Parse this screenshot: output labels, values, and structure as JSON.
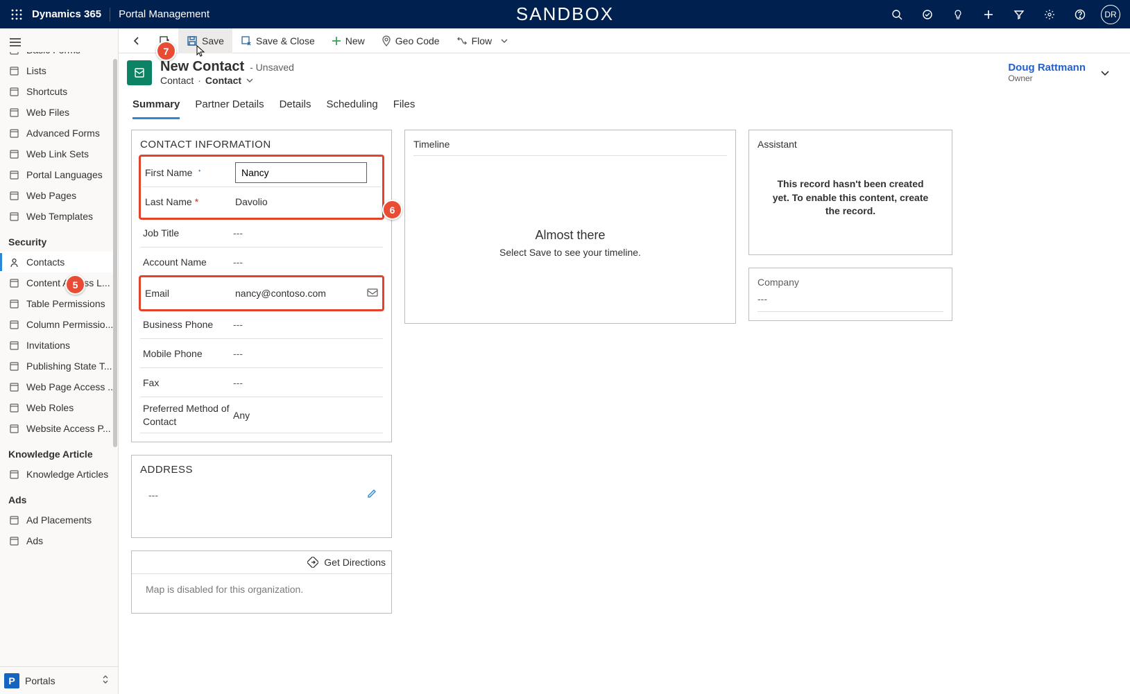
{
  "topbar": {
    "brand": "Dynamics 365",
    "area": "Portal Management",
    "center": "SANDBOX",
    "avatar": "DR"
  },
  "sidebar": {
    "items_top": [
      {
        "icon": "form",
        "label": "Basic Forms"
      },
      {
        "icon": "list",
        "label": "Lists"
      },
      {
        "icon": "link",
        "label": "Shortcuts"
      },
      {
        "icon": "file",
        "label": "Web Files"
      },
      {
        "icon": "form",
        "label": "Advanced Forms"
      },
      {
        "icon": "list",
        "label": "Web Link Sets"
      },
      {
        "icon": "file",
        "label": "Portal Languages"
      },
      {
        "icon": "file",
        "label": "Web Pages"
      },
      {
        "icon": "file",
        "label": "Web Templates"
      }
    ],
    "group_security": "Security",
    "items_security": [
      {
        "icon": "person",
        "label": "Contacts",
        "active": true
      },
      {
        "icon": "file",
        "label": "Content Access L..."
      },
      {
        "icon": "table",
        "label": "Table Permissions"
      },
      {
        "icon": "column",
        "label": "Column Permissio..."
      },
      {
        "icon": "mail",
        "label": "Invitations"
      },
      {
        "icon": "flow",
        "label": "Publishing State T..."
      },
      {
        "icon": "file",
        "label": "Web Page Access ..."
      },
      {
        "icon": "gear",
        "label": "Web Roles"
      },
      {
        "icon": "file",
        "label": "Website Access P..."
      }
    ],
    "group_knowledge": "Knowledge Article",
    "items_knowledge": [
      {
        "icon": "book",
        "label": "Knowledge Articles"
      }
    ],
    "group_ads": "Ads",
    "items_ads": [
      {
        "icon": "ad",
        "label": "Ad Placements"
      },
      {
        "icon": "ad",
        "label": "Ads"
      }
    ],
    "footer_badge": "P",
    "footer_label": "Portals"
  },
  "cmdbar": {
    "back": "",
    "new_deactivated": "",
    "save": "Save",
    "save_close": "Save & Close",
    "new": "New",
    "geo": "Geo Code",
    "flow": "Flow"
  },
  "header": {
    "title": "New Contact",
    "state": "- Unsaved",
    "crumb1": "Contact",
    "crumb2": "Contact",
    "owner_name": "Doug Rattmann",
    "owner_role": "Owner"
  },
  "tabs": [
    "Summary",
    "Partner Details",
    "Details",
    "Scheduling",
    "Files"
  ],
  "form": {
    "section": "CONTACT INFORMATION",
    "first_name_label": "First Name",
    "first_name_value": "Nancy",
    "last_name_label": "Last Name",
    "last_name_value": "Davolio",
    "job_title_label": "Job Title",
    "job_title_value": "---",
    "account_label": "Account Name",
    "account_value": "---",
    "email_label": "Email",
    "email_value": "nancy@contoso.com",
    "bphone_label": "Business Phone",
    "bphone_value": "---",
    "mphone_label": "Mobile Phone",
    "mphone_value": "---",
    "fax_label": "Fax",
    "fax_value": "---",
    "pmoc_label": "Preferred Method of Contact",
    "pmoc_value": "Any"
  },
  "address": {
    "section": "ADDRESS",
    "value": "---",
    "get_directions": "Get Directions",
    "map_msg": "Map is disabled for this organization."
  },
  "timeline": {
    "title": "Timeline",
    "heading": "Almost there",
    "sub": "Select Save to see your timeline."
  },
  "assistant": {
    "title": "Assistant",
    "msg": "This record hasn't been created yet. To enable this content, create the record."
  },
  "company": {
    "label": "Company",
    "value": "---"
  },
  "callouts": {
    "c5": "5",
    "c6": "6",
    "c7": "7"
  }
}
